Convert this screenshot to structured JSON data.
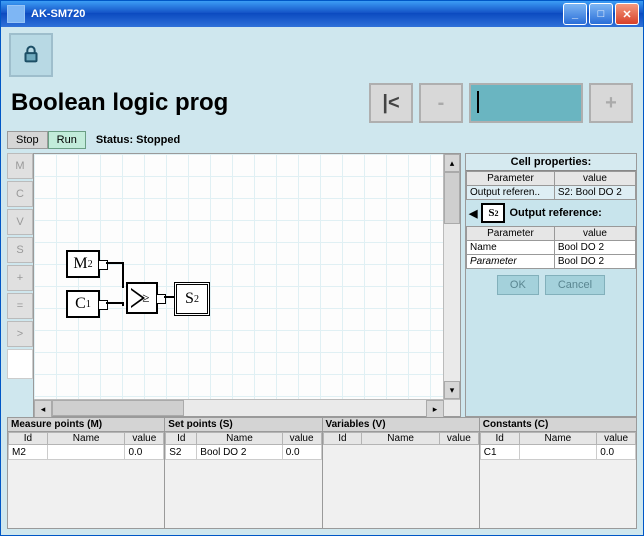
{
  "title": "AK-SM720",
  "lock_icon": "lock-icon",
  "page_title": "Boolean logic prog",
  "nav": {
    "first": "|<",
    "prev": "-",
    "field": "",
    "next": "+"
  },
  "controls": {
    "stop": "Stop",
    "run": "Run",
    "status": "Status: Stopped"
  },
  "palette": [
    "M",
    "C",
    "V",
    "S",
    "+",
    "=",
    ">"
  ],
  "nodes": {
    "m2": {
      "main": "M",
      "sub": "2"
    },
    "c1": {
      "main": "C",
      "sub": "1"
    },
    "cmp": {
      "sym": "≥"
    },
    "s2": {
      "main": "S",
      "sub": "2"
    }
  },
  "props": {
    "cell_header": "Cell properties:",
    "cols": {
      "param": "Parameter",
      "value": "value"
    },
    "row1": {
      "param": "Output referen..",
      "value": "S2: Bool DO 2"
    },
    "output_ref_label": "Output reference:",
    "s2icon": {
      "main": "S",
      "sub": "2"
    },
    "row2": {
      "param": "Name",
      "value": "Bool DO 2"
    },
    "row3": {
      "param": "Parameter",
      "value": "Bool DO 2"
    },
    "ok": "OK",
    "cancel": "Cancel"
  },
  "bottom": {
    "cols": {
      "id": "Id",
      "name": "Name",
      "value": "value"
    },
    "measure": {
      "title": "Measure points (M)",
      "rows": [
        {
          "id": "M2",
          "name": "",
          "value": "0.0"
        }
      ]
    },
    "set": {
      "title": "Set points (S)",
      "rows": [
        {
          "id": "S2",
          "name": "Bool DO 2",
          "value": "0.0"
        }
      ]
    },
    "vars": {
      "title": "Variables (V)",
      "rows": []
    },
    "consts": {
      "title": "Constants (C)",
      "rows": [
        {
          "id": "C1",
          "name": "",
          "value": "0.0"
        }
      ]
    }
  }
}
